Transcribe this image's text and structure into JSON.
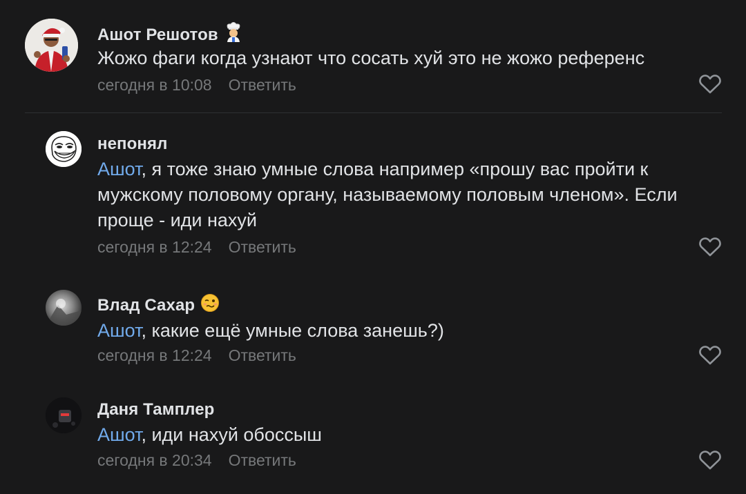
{
  "comments": [
    {
      "author": "Ашот Решотов",
      "author_emoji": "cook-emoji",
      "mention": "",
      "text": "Жожо фаги когда узнают что сосать хуй это не жожо референс",
      "time": "сегодня в 10:08",
      "reply_label": "Ответить"
    },
    {
      "author": "непонял",
      "author_emoji": "",
      "mention": "Ашот",
      "text": ", я тоже знаю умные слова например «прошу вас пройти к мужскому половому органу, называемому половым членом». Если проще - иди нахуй",
      "time": "сегодня в 12:24",
      "reply_label": "Ответить"
    },
    {
      "author": "Влад Сахар",
      "author_emoji": "woozy-face-emoji",
      "mention": "Ашот",
      "text": ", какие ещё умные слова занешь?)",
      "time": "сегодня в 12:24",
      "reply_label": "Ответить"
    },
    {
      "author": "Даня Тамплер",
      "author_emoji": "",
      "mention": "Ашот",
      "text": ", иди нахуй обоссыш",
      "time": "сегодня в 20:34",
      "reply_label": "Ответить"
    }
  ],
  "icons": {
    "like": "heart-outline-icon"
  },
  "colors": {
    "background": "#19191a",
    "text": "#e1e3e6",
    "secondary": "#76787a",
    "mention": "#71aaeb",
    "divider": "#2f3033"
  }
}
